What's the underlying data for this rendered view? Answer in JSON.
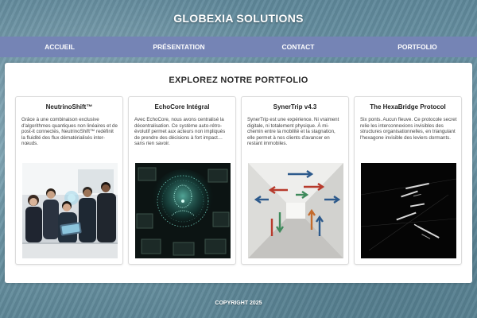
{
  "site": {
    "title": "GLOBEXIA SOLUTIONS"
  },
  "nav": {
    "items": [
      {
        "label": "ACCUEIL"
      },
      {
        "label": "PRÉSENTATION"
      },
      {
        "label": "CONTACT"
      },
      {
        "label": "PORTFOLIO"
      }
    ]
  },
  "portfolio": {
    "title": "EXPLOREZ NOTRE PORTFOLIO",
    "cards": [
      {
        "title": "NeutrinoShift™",
        "description": "Grâce à une combinaison exclusive d'algorithmes quantiques non linéaires et de post-it connectés, NeutrinoShift™ redéfinit la fluidité des flux dématérialisés inter-nœuds."
      },
      {
        "title": "EchoCore Intégral",
        "description": "Avec EchoCore, nous avons centralisé la décentralisation. Ce système auto-rétro-évolutif permet aux acteurs non impliqués de prendre des décisions à fort impact… sans rien savoir."
      },
      {
        "title": "SynerTrip v4.3",
        "description": "SynerTrip est une expérience. Ni vraiment digitale, ni totalement physique. À mi-chemin entre la mobilité et la stagnation, elle permet à nos clients d'avancer en restant immobiles."
      },
      {
        "title": "The HexaBridge Protocol",
        "description": "Six ponts. Aucun fleuve. Ce protocole secret relie les interconnexions invisibles des structures organisationnelles, en triangulant l'hexagone invisible des leviers dormants."
      }
    ]
  },
  "footer": {
    "copyright": "COPYRIGHT 2025"
  },
  "colors": {
    "nav_bg": "#7584b5",
    "panel_bg": "#ffffff",
    "page_bg": "#6f97a8"
  }
}
